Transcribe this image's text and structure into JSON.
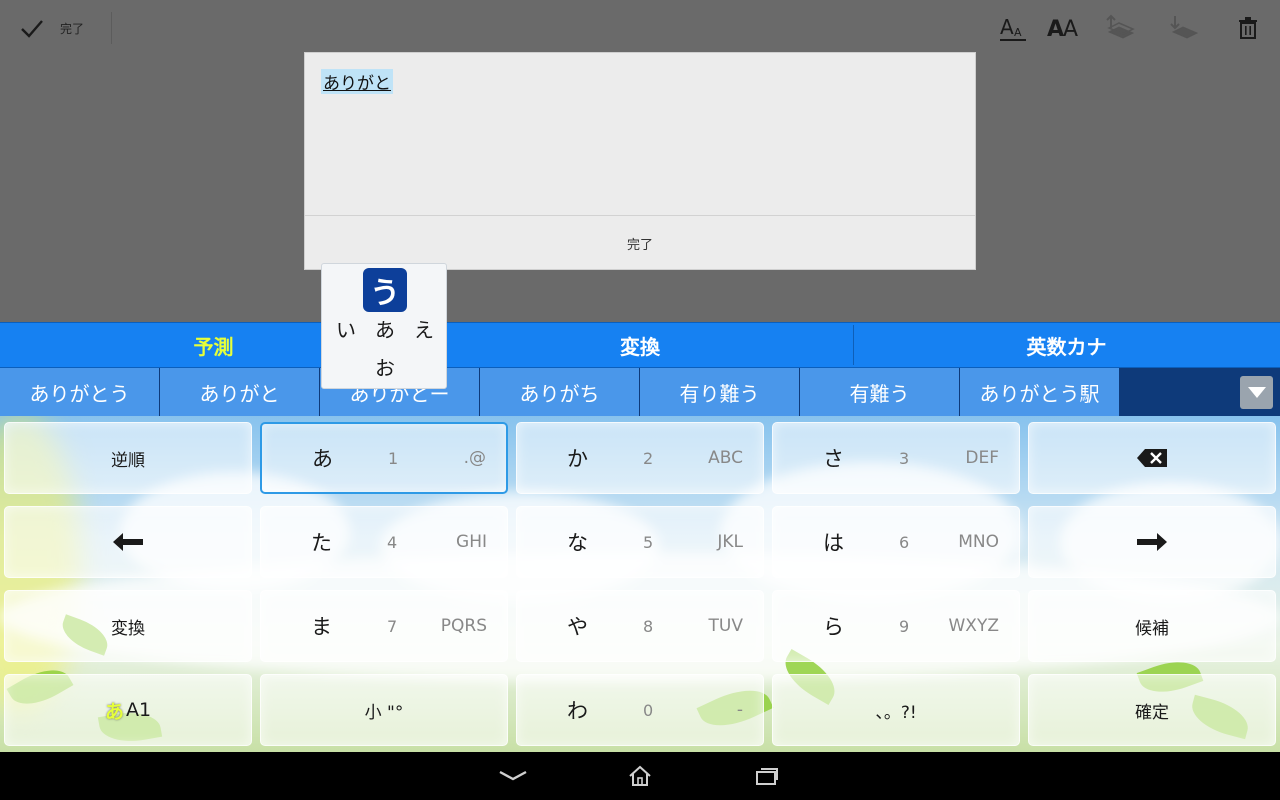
{
  "topbar": {
    "done_label": "完了",
    "icons": [
      "check-icon",
      "text-size-small-icon",
      "text-size-large-icon",
      "bring-forward-icon",
      "send-backward-icon",
      "trash-icon"
    ]
  },
  "dialog": {
    "input_text": "ありがと",
    "ok_label": "完了"
  },
  "keyboard": {
    "modes": [
      "予測",
      "変換",
      "英数カナ"
    ],
    "active_mode": "予測",
    "active_mode_color": "#e6ff3a",
    "candidates": [
      "ありがとう",
      "ありがと",
      "ありがとー",
      "ありがち",
      "有り難う",
      "有難う",
      "ありがとう駅"
    ],
    "keys": {
      "reverse": "逆順",
      "a": {
        "kana": "あ",
        "num": "1",
        "alpha": ".@"
      },
      "ka": {
        "kana": "か",
        "num": "2",
        "alpha": "ABC"
      },
      "sa": {
        "kana": "さ",
        "num": "3",
        "alpha": "DEF"
      },
      "ta": {
        "kana": "た",
        "num": "4",
        "alpha": "GHI"
      },
      "na": {
        "kana": "な",
        "num": "5",
        "alpha": "JKL"
      },
      "ha": {
        "kana": "は",
        "num": "6",
        "alpha": "MNO"
      },
      "convert": "変換",
      "ma": {
        "kana": "ま",
        "num": "7",
        "alpha": "PQRS"
      },
      "ya": {
        "kana": "や",
        "num": "8",
        "alpha": "TUV"
      },
      "ra": {
        "kana": "ら",
        "num": "9",
        "alpha": "WXYZ"
      },
      "candidates": "候補",
      "mode_kana": "あ",
      "mode_alpha": "A1",
      "small": "小 \"°",
      "wa": {
        "kana": "わ",
        "num": "0",
        "alpha": "-"
      },
      "punct": "、。?!",
      "confirm": "確定"
    },
    "flick": {
      "center": "う",
      "left": "い",
      "mid": "あ",
      "right": "え",
      "bottom": "お"
    }
  },
  "colors": {
    "mode_bar": "#1681f2",
    "candidate_bg": "#4a97ea",
    "flick_center": "#0d3f9a"
  }
}
